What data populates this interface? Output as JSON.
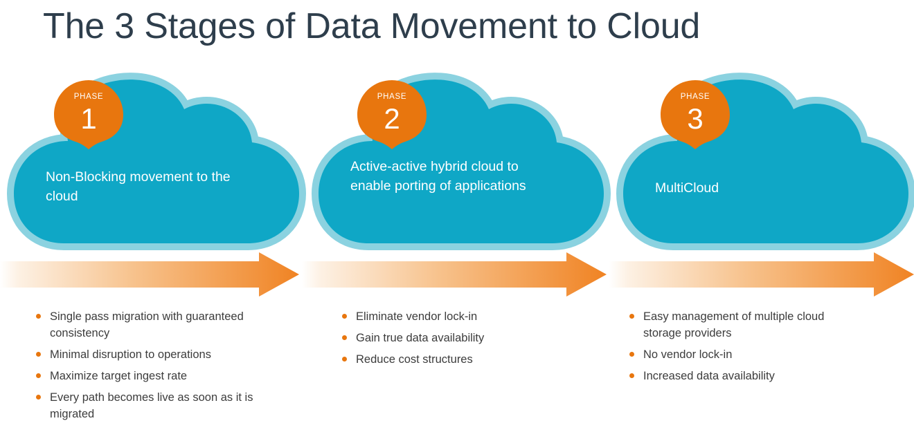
{
  "title": "The 3 Stages of Data Movement to Cloud",
  "colors": {
    "title": "#2E3E4C",
    "cloud_fill": "#0FA7C6",
    "cloud_outline": "#8BD2E0",
    "badge": "#E8760E",
    "arrow_solid": "#F08323",
    "arrow_fade": "#FDF3E9",
    "bullet_dot": "#E8760E",
    "bullet_text": "#3C3C3C",
    "cloud_text": "#FFFFFF"
  },
  "phases": [
    {
      "badge_label": "PHASE",
      "badge_number": "1",
      "cloud_text": "Non-Blocking movement to the cloud",
      "cloud_lines": 2,
      "bullets": [
        "Single pass migration with guaranteed consistency",
        "Minimal disruption to operations",
        "Maximize target ingest rate",
        "Every path becomes live as soon as it is migrated"
      ]
    },
    {
      "badge_label": "PHASE",
      "badge_number": "2",
      "cloud_text": "Active-active hybrid cloud to enable porting of applications",
      "cloud_lines": 3,
      "bullets": [
        "Eliminate vendor lock-in",
        "Gain true data availability",
        "Reduce cost structures"
      ]
    },
    {
      "badge_label": "PHASE",
      "badge_number": "3",
      "cloud_text": "MultiCloud",
      "cloud_lines": 1,
      "bullets": [
        "Easy management of multiple cloud storage providers",
        "No vendor lock-in",
        "Increased data availability"
      ]
    }
  ],
  "arrows": {
    "count": 3,
    "direction": "right",
    "icon": "right-arrow-icon"
  }
}
